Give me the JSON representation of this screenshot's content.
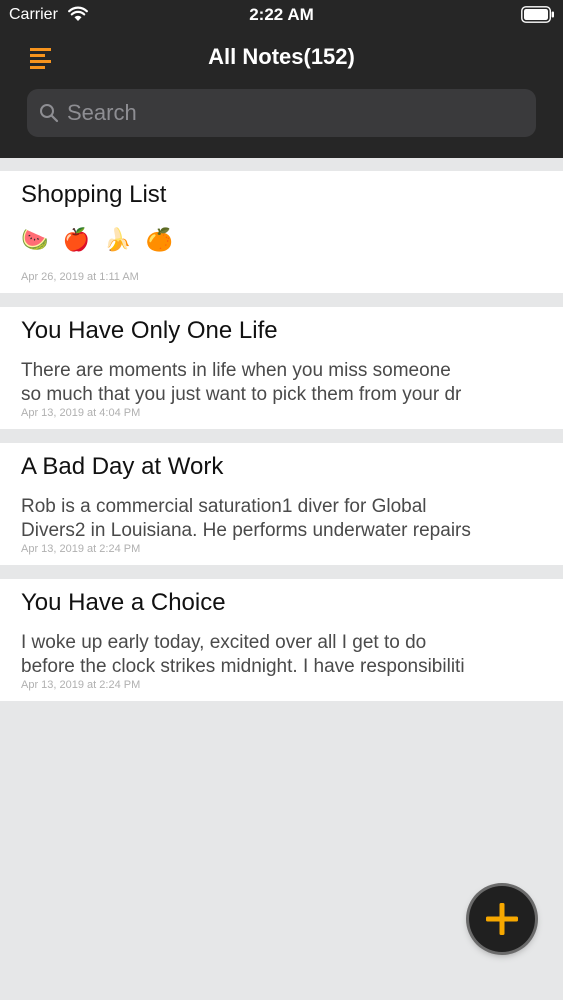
{
  "status_bar": {
    "carrier": "Carrier",
    "time": "2:22 AM"
  },
  "nav": {
    "title": "All Notes(152)",
    "menu_icon": "menu-lines-icon",
    "accent_color": "#f7941d"
  },
  "search": {
    "placeholder": "Search",
    "value": ""
  },
  "notes": [
    {
      "title": "Shopping List",
      "body": "🍉 🍎 🍌 🍊",
      "date": "Apr 26, 2019 at 1:11 AM"
    },
    {
      "title": "You Have Only One Life",
      "body": "There are moments in life when you miss someone\nso much that you just want to pick them from your dr",
      "date": "Apr 13, 2019 at 4:04 PM"
    },
    {
      "title": "A Bad Day at Work",
      "body": "Rob is a commercial saturation1 diver for Global\nDivers2 in Louisiana. He performs underwater repairs",
      "date": "Apr 13, 2019 at 2:24 PM"
    },
    {
      "title": "You Have a Choice",
      "body": "I woke up early today, excited over all I get to do\nbefore the clock strikes midnight. I have responsibiliti",
      "date": "Apr 13, 2019 at 2:24 PM"
    }
  ],
  "fab": {
    "icon": "plus-icon",
    "color": "#f7a800"
  }
}
